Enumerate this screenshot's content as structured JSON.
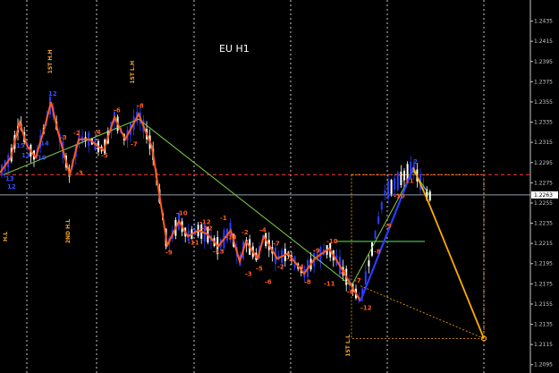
{
  "chart_data": {
    "type": "candlestick",
    "title": "EU H1",
    "ylim": [
      1.2093,
      1.2447
    ],
    "y_ticks": [
      "1.2435",
      "1.2415",
      "1.2395",
      "1.2375",
      "1.2355",
      "1.2335",
      "1.2315",
      "1.2295",
      "1.2275",
      "1.2255",
      "1.2235",
      "1.2215",
      "1.2195",
      "1.2175",
      "1.2155",
      "1.2135",
      "1.2115",
      "1.2095"
    ],
    "current_price": "1.2263",
    "colors": {
      "bull_candle": "#2b3cff",
      "bear_candle": "#ffffff",
      "wave_line": "#ff5a1f",
      "impulse_line": "#2b3cff",
      "trend_line": "#7fd14a",
      "projection_line": "#ffaa00",
      "resistance_line": "#ff3a3a",
      "support_line": "#3fbf3f",
      "label_orange": "#ff5a1f",
      "label_blue": "#3050ff",
      "vertical_text": "#f5a623"
    },
    "vertical_labels": [
      "H.L",
      "1ST H.H",
      "1ST L.H",
      "2ND H.L",
      "1ST L.L"
    ],
    "wave_labels": [
      "13",
      "15",
      "14",
      "12",
      "12",
      "10",
      "13",
      "-3",
      "-2",
      "-3",
      "-4",
      "-5",
      "-6",
      "-7",
      "-8",
      "-9",
      "-10",
      "-11",
      "-12",
      "-13",
      "-2",
      "-3",
      "-4",
      "-5",
      "-6",
      "-7",
      "-8",
      "-9",
      "-10",
      "-11",
      "-12",
      "-13",
      "-1",
      "-2",
      "-3",
      "-4",
      "-5",
      "-6",
      "-7",
      "-8",
      "-9",
      "-10",
      "-11",
      "-12",
      "2"
    ],
    "wave_points": [
      {
        "x": 0,
        "y": 1.2285
      },
      {
        "x": 12,
        "y": 1.23
      },
      {
        "x": 22,
        "y": 1.2335
      },
      {
        "x": 30,
        "y": 1.2312
      },
      {
        "x": 40,
        "y": 1.23
      },
      {
        "x": 50,
        "y": 1.233
      },
      {
        "x": 57,
        "y": 1.2355
      },
      {
        "x": 65,
        "y": 1.2325
      },
      {
        "x": 78,
        "y": 1.2283
      },
      {
        "x": 88,
        "y": 1.2318
      },
      {
        "x": 100,
        "y": 1.2318
      },
      {
        "x": 108,
        "y": 1.2312
      },
      {
        "x": 116,
        "y": 1.2307
      },
      {
        "x": 128,
        "y": 1.234
      },
      {
        "x": 140,
        "y": 1.2318
      },
      {
        "x": 155,
        "y": 1.2343
      },
      {
        "x": 170,
        "y": 1.231
      },
      {
        "x": 187,
        "y": 1.2213
      },
      {
        "x": 200,
        "y": 1.2237
      },
      {
        "x": 210,
        "y": 1.2222
      },
      {
        "x": 222,
        "y": 1.2228
      },
      {
        "x": 232,
        "y": 1.2224
      },
      {
        "x": 244,
        "y": 1.2212
      },
      {
        "x": 258,
        "y": 1.2228
      },
      {
        "x": 268,
        "y": 1.2197
      },
      {
        "x": 275,
        "y": 1.2217
      },
      {
        "x": 288,
        "y": 1.22
      },
      {
        "x": 295,
        "y": 1.2222
      },
      {
        "x": 310,
        "y": 1.22
      },
      {
        "x": 322,
        "y": 1.2205
      },
      {
        "x": 340,
        "y": 1.2185
      },
      {
        "x": 352,
        "y": 1.22
      },
      {
        "x": 368,
        "y": 1.221
      },
      {
        "x": 380,
        "y": 1.2193
      },
      {
        "x": 395,
        "y": 1.217
      },
      {
        "x": 403,
        "y": 1.2158
      }
    ],
    "impulse_points": [
      {
        "x": 403,
        "y": 1.2158
      },
      {
        "x": 462,
        "y": 1.229
      }
    ],
    "projection_points": [
      {
        "x": 462,
        "y": 1.229
      },
      {
        "x": 478,
        "y": 1.2258
      },
      {
        "x": 541,
        "y": 1.2121
      }
    ],
    "trend_points": [
      {
        "x": 4,
        "y": 1.2283
      },
      {
        "x": 155,
        "y": 1.2338
      },
      {
        "x": 393,
        "y": 1.2173
      },
      {
        "x": 462,
        "y": 1.2287
      },
      {
        "x": 480,
        "y": 1.2263
      }
    ],
    "resistance_level": 1.2283,
    "support_level": 1.2217,
    "projection_box": {
      "x0": 393,
      "x1": 541,
      "y0": 1.2283,
      "y1": 1.2121
    }
  }
}
